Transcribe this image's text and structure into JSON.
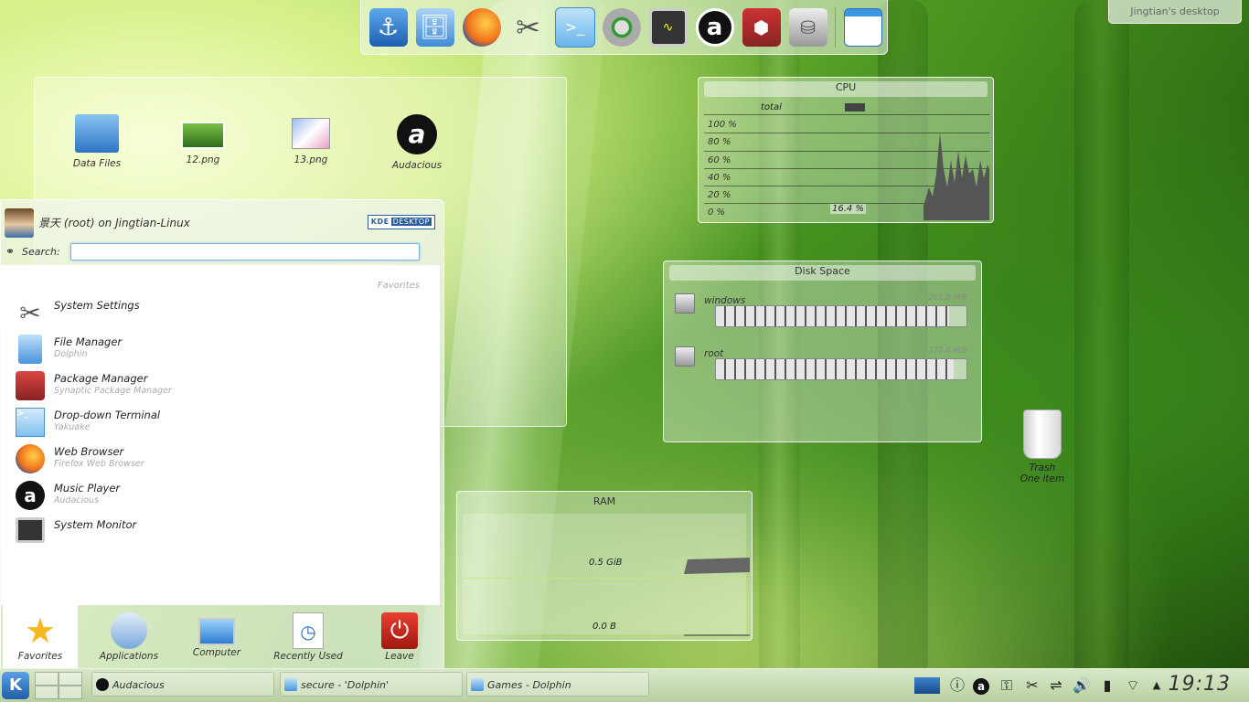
{
  "desktop": {
    "label": "Jingtian's desktop"
  },
  "top_panel": {
    "launchers": [
      "anchor-icon",
      "file-manager-icon",
      "firefox-icon",
      "system-settings-icon",
      "terminal-icon",
      "network-icon",
      "system-monitor-icon",
      "audacious-icon",
      "package-manager-icon",
      "disk-icon",
      "window-icon"
    ]
  },
  "folder_view": {
    "items": [
      {
        "label": "Data Files",
        "icon": "folder-icon"
      },
      {
        "label": "12.png",
        "icon": "image-icon"
      },
      {
        "label": "13.png",
        "icon": "image-icon"
      },
      {
        "label": "Audacious",
        "icon": "audacious-icon"
      }
    ]
  },
  "kickoff": {
    "user": "景天 (root) on Jingtian-Linux",
    "badge_kde": "KDE",
    "badge_desktop": "DESKTOP",
    "search_label": "Search:",
    "search_value": "",
    "section": "Favorites",
    "items": [
      {
        "name": "System Settings",
        "sub": ""
      },
      {
        "name": "File Manager",
        "sub": "Dolphin"
      },
      {
        "name": "Package Manager",
        "sub": "Synaptic Package Manager"
      },
      {
        "name": "Drop-down Terminal",
        "sub": "Yakuake"
      },
      {
        "name": "Web Browser",
        "sub": "Firefox Web Browser"
      },
      {
        "name": "Music Player",
        "sub": "Audacious"
      },
      {
        "name": "System Monitor",
        "sub": ""
      }
    ],
    "tabs": [
      "Favorites",
      "Applications",
      "Computer",
      "Recently Used",
      "Leave"
    ]
  },
  "cpu": {
    "title": "CPU",
    "legend": "total",
    "ylabels": [
      "100 %",
      "80 %",
      "60 %",
      "40 %",
      "20 %",
      "0 %"
    ],
    "current": "16.4 %"
  },
  "disk": {
    "title": "Disk Space",
    "disks": [
      {
        "name": "windows",
        "size": "201.9 MiB",
        "used_fraction": 0.93
      },
      {
        "name": "root",
        "size": "172.4 MiB",
        "used_fraction": 0.95
      }
    ]
  },
  "ram": {
    "title": "RAM",
    "mid_label": "0.5 GiB",
    "low_label": "0.0 B"
  },
  "trash": {
    "label": "Trash",
    "count": "One item"
  },
  "taskbar": {
    "tasks": [
      "Audacious",
      "secure - 'Dolphin'",
      "Games - Dolphin"
    ],
    "clock": "19:13"
  }
}
